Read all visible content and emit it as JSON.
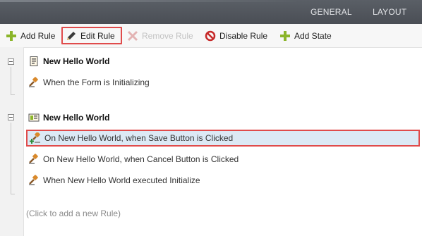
{
  "tabs": [
    {
      "label": "GENERAL"
    },
    {
      "label": "LAYOUT"
    }
  ],
  "toolbar": {
    "add_rule": "Add Rule",
    "edit_rule": "Edit Rule",
    "remove_rule": "Remove Rule",
    "disable_rule": "Disable Rule",
    "add_state": "Add State"
  },
  "groups": [
    {
      "title": "New Hello World",
      "icon": "form-icon",
      "rules": [
        {
          "label": "When the Form is Initializing",
          "icon": "gavel-icon"
        }
      ]
    },
    {
      "title": "New Hello World",
      "icon": "view-icon",
      "rules": [
        {
          "label": "On New Hello World, when Save Button is Clicked",
          "icon": "gavel-add-icon",
          "selected": true
        },
        {
          "label": "On New Hello World, when Cancel Button is Clicked",
          "icon": "gavel-icon"
        },
        {
          "label": "When New Hello World executed Initialize",
          "icon": "gavel-icon"
        }
      ]
    }
  ],
  "add_rule_hint": "(Click to add a new Rule)",
  "colors": {
    "accent_red": "#e04b4b",
    "selected_row": "#dce9f5",
    "add_green": "#8bb52a",
    "disable_red": "#c62828",
    "gavel_orange": "#d9892b"
  }
}
